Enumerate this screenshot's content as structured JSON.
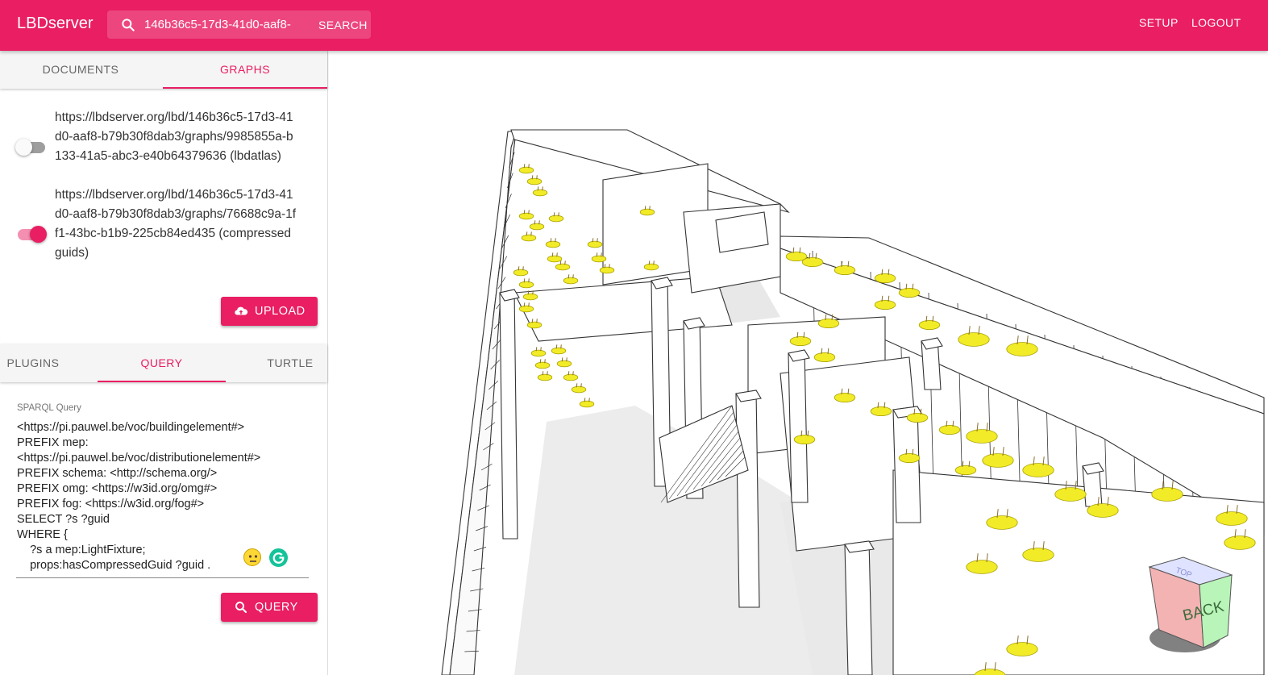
{
  "header": {
    "brand": "LBDserver",
    "search_value": "146b36c5-17d3-41d0-aaf8-",
    "search_button": "SEARCH",
    "setup": "SETUP",
    "logout": "LOGOUT",
    "accent_color": "#e91e63"
  },
  "sidebar": {
    "top_tabs": [
      {
        "label": "DOCUMENTS",
        "active": false
      },
      {
        "label": "GRAPHS",
        "active": true
      }
    ],
    "graphs": [
      {
        "label": "https://lbdserver.org/lbd/146b36c5-17d3-41d0-aaf8-b79b30f8dab3/graphs/9985855a-b133-41a5-abc3-e40b64379636 (lbdatlas)",
        "enabled": false
      },
      {
        "label": "https://lbdserver.org/lbd/146b36c5-17d3-41d0-aaf8-b79b30f8dab3/graphs/76688c9a-1ff1-43bc-b1b9-225cb84ed435 (compressedguids)",
        "enabled": true
      }
    ],
    "upload_button": "UPLOAD",
    "bottom_tabs": [
      {
        "label": "PLUGINS",
        "active": false
      },
      {
        "label": "QUERY",
        "active": true
      },
      {
        "label": "TURTLE",
        "active": false
      }
    ],
    "query_label": "SPARQL Query",
    "query_text": "<https://pi.pauwel.be/voc/buildingelement#>\nPREFIX mep:\n<https://pi.pauwel.be/voc/distributionelement#>\nPREFIX schema: <http://schema.org/>\nPREFIX omg: <https://w3id.org/omg#>\nPREFIX fog: <https://w3id.org/fog#>\nSELECT ?s ?guid\nWHERE {\n    ?s a mep:LightFixture;\n    props:hasCompressedGuid ?guid .",
    "query_button": "QUERY"
  },
  "viewer": {
    "nav_cube_top": "TOP",
    "nav_cube_front": "BACK"
  }
}
